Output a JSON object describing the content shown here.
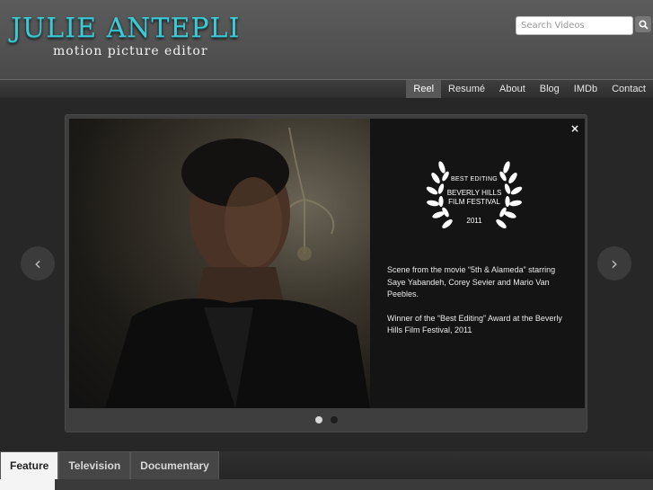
{
  "site": {
    "title": "Julie Antepli",
    "subtitle": "motion picture editor"
  },
  "search": {
    "placeholder": "Search Videos",
    "icon": "search-icon"
  },
  "nav": {
    "items": [
      {
        "label": "Reel",
        "active": true
      },
      {
        "label": "Resumé",
        "active": false
      },
      {
        "label": "About",
        "active": false
      },
      {
        "label": "Blog",
        "active": false
      },
      {
        "label": "IMDb",
        "active": false
      },
      {
        "label": "Contact",
        "active": false
      }
    ]
  },
  "slide": {
    "laurel_award": "BEST EDITING",
    "laurel_festival_line1": "BEVERLY HILLS",
    "laurel_festival_line2": "FILM FESTIVAL",
    "laurel_year": "2011",
    "caption_1": "Scene from the movie “5th & Alameda” starring Saye Yabandeh, Corey Sevier and Mario Van Peebles.",
    "caption_2": "Winner of the “Best Editing” Award at the Beverly Hills Film Festival, 2011",
    "close_symbol": "×",
    "prev_symbol": "‹",
    "next_symbol": "›",
    "dots": [
      true,
      false
    ]
  },
  "tabs": {
    "items": [
      {
        "label": "Feature",
        "active": true
      },
      {
        "label": "Television",
        "active": false
      },
      {
        "label": "Documentary",
        "active": false
      }
    ]
  },
  "colors": {
    "accent": "#3fc9d4",
    "header_bg": "#555555",
    "page_bg": "#272727"
  }
}
